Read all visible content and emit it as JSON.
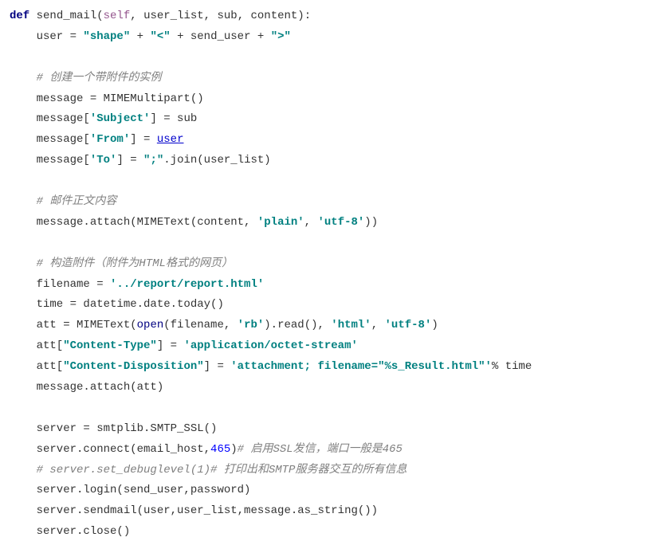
{
  "code": {
    "l1": {
      "def": "def",
      "fn": "send_mail",
      "self": "self",
      "params": ", user_list, sub, content):"
    },
    "l2": {
      "a": "    user = ",
      "s1": "\"shape\"",
      "b": " + ",
      "s2": "\"<\"",
      "c": " + send_user + ",
      "s3": "\">\""
    },
    "l3": "",
    "l4": {
      "cmt": "    # 创建一个带附件的实例"
    },
    "l5": "    message = MIMEMultipart()",
    "l6": {
      "a": "    message[",
      "s": "'Subject'",
      "b": "] = sub"
    },
    "l7": {
      "a": "    message[",
      "s": "'From'",
      "b": "] = ",
      "link": "user"
    },
    "l8": {
      "a": "    message[",
      "s": "'To'",
      "b": "] = ",
      "s2": "\";\"",
      "c": ".join(user_list)"
    },
    "l9": "",
    "l10": {
      "cmt": "    # 邮件正文内容"
    },
    "l11": {
      "a": "    message.attach(MIMEText(content, ",
      "s1": "'plain'",
      "b": ", ",
      "s2": "'utf-8'",
      "c": "))"
    },
    "l12": "",
    "l13": {
      "cmt": "    # 构造附件（附件为HTML格式的网页）"
    },
    "l14": {
      "a": "    filename = ",
      "s": "'../report/report.html'"
    },
    "l15": "    time = datetime.date.today()",
    "l16": {
      "a": "    att = MIMEText(",
      "open": "open",
      "b": "(filename, ",
      "s1": "'rb'",
      "c": ").read(), ",
      "s2": "'html'",
      "d": ", ",
      "s3": "'utf-8'",
      "e": ")"
    },
    "l17": {
      "a": "    att[",
      "s1": "\"Content-Type\"",
      "b": "] = ",
      "s2": "'application/octet-stream'"
    },
    "l18": {
      "a": "    att[",
      "s1": "\"Content-Disposition\"",
      "b": "] = ",
      "s2": "'attachment; filename=\"%s_Result.html\"'",
      "c": "% time"
    },
    "l19": "    message.attach(att)",
    "l20": "",
    "l21": "    server = smtplib.SMTP_SSL()",
    "l22": {
      "a": "    server.connect(email_host,",
      "num": "465",
      "b": ")",
      "cmt": "# 启用SSL发信，端口一般是465"
    },
    "l23": {
      "cmt": "    # server.set_debuglevel(1)# 打印出和SMTP服务器交互的所有信息"
    },
    "l24": "    server.login(send_user,password)",
    "l25": "    server.sendmail(user,user_list,message.as_string())",
    "l26": "    server.close()"
  }
}
